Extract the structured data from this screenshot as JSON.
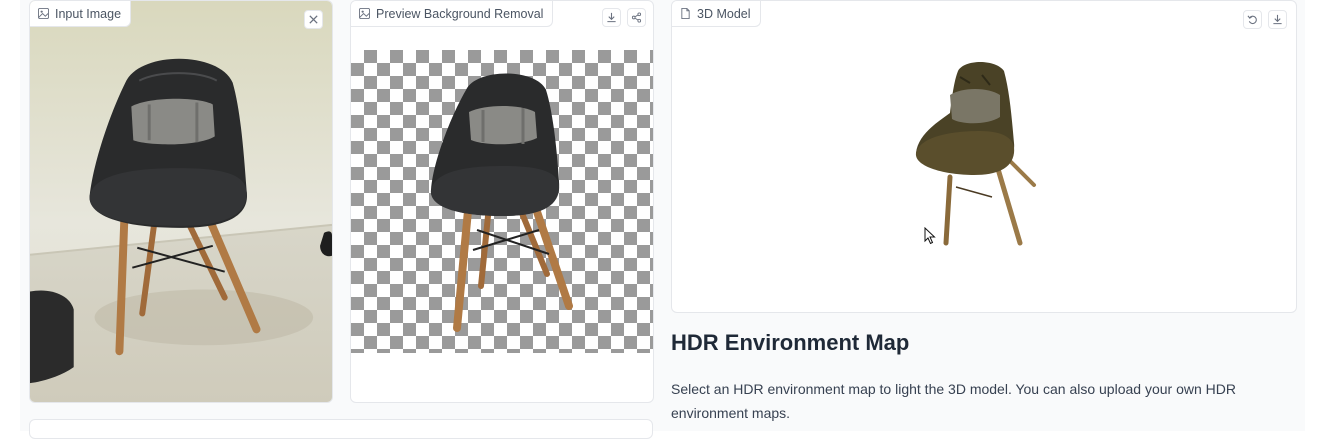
{
  "panels": {
    "input": {
      "label": "Input Image",
      "close_icon": "close-icon",
      "icon": "image-icon"
    },
    "preview": {
      "label": "Preview Background Removal",
      "icon": "image-icon",
      "actions": [
        "download-icon",
        "share-icon"
      ]
    },
    "model": {
      "label": "3D Model",
      "icon": "file-icon",
      "actions": [
        "undo-icon",
        "download-icon"
      ]
    }
  },
  "hdr": {
    "title": "HDR Environment Map",
    "description": "Select an HDR environment map to light the 3D model. You can also upload your own HDR environment maps."
  },
  "colors": {
    "wood": "#b07a45",
    "leather": "#2a2b2c",
    "checker": "#9a9a9a"
  }
}
